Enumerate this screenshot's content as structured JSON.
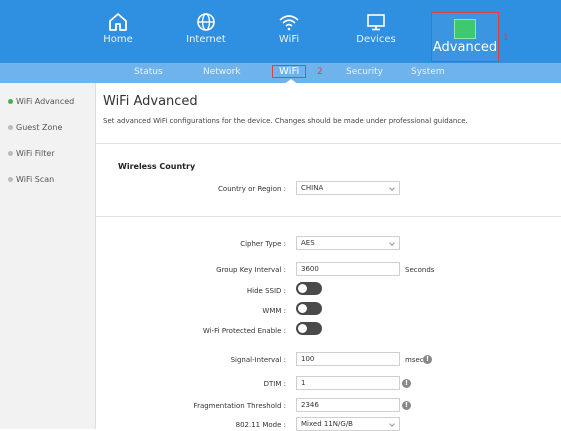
{
  "topnav": {
    "items": [
      {
        "label": "Home",
        "icon": "home-icon"
      },
      {
        "label": "Internet",
        "icon": "globe-icon"
      },
      {
        "label": "WiFi",
        "icon": "wifi-icon"
      },
      {
        "label": "Devices",
        "icon": "devices-icon"
      },
      {
        "label": "Advanced",
        "icon": "advanced-icon"
      }
    ],
    "callout": "1"
  },
  "subnav": {
    "items": [
      "Status",
      "Network",
      "WiFi",
      "Security",
      "System"
    ],
    "callout": "2"
  },
  "sidebar": {
    "items": [
      "WiFi Advanced",
      "Guest Zone",
      "WiFi Filter",
      "WiFi Scan"
    ]
  },
  "main": {
    "title": "WiFi Advanced",
    "description": "Set advanced WiFi configurations for the device. Changes should be made under professional guidance.",
    "wireless_country": {
      "section_title": "Wireless Country",
      "label": "Country or Region :",
      "value": "CHINA"
    },
    "fields": {
      "cipher_label": "Cipher Type :",
      "cipher_value": "AES",
      "group_key_label": "Group Key Interval :",
      "group_key_value": "3600",
      "group_key_unit": "Seconds",
      "hide_ssid_label": "Hide SSID :",
      "wmm_label": "WMM :",
      "wps_label": "Wi-Fi Protected Enable :",
      "signal_label": "Signal-Interval :",
      "signal_value": "100",
      "signal_unit": "msec",
      "dtim_label": "DTIM :",
      "dtim_value": "1",
      "frag_label": "Fragmentation Threshold :",
      "frag_value": "2346",
      "mode_label": "802.11 Mode :",
      "mode_value": "Mixed 11N/G/B"
    }
  },
  "colors": {
    "nav_bg": "#2f8fe0",
    "subnav_bg": "#6fb3ec",
    "highlight": "#e04040",
    "active_dot": "#3fb24a"
  }
}
